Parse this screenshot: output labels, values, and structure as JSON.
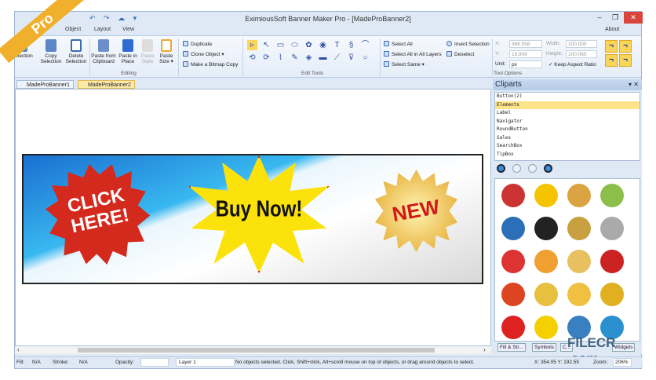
{
  "window": {
    "title": "EximiousSoft Banner Maker Pro - [MadeProBanner2]",
    "minimize": "–",
    "restore": "❐",
    "close": "✕",
    "about": "About",
    "pro_badge": "Pro",
    "qat": "↶ ↷ ☁ ▾"
  },
  "menu": [
    "Object",
    "Layout",
    "View"
  ],
  "ribbon": {
    "editing": {
      "buttons": [
        "Selection",
        "Copy Selection",
        "Delete Selection",
        "Paste from Clipboard",
        "Paste in Place",
        "Paste Style",
        "Paste Size ▾"
      ],
      "label": "Editing"
    },
    "dup": [
      "Duplicate",
      "Clone Object ▾",
      "Make a Bitmap Copy"
    ],
    "edit_tools": {
      "label": "Edit Tools",
      "tools": [
        "▹",
        "↖",
        "▭",
        "⬭",
        "✿",
        "◉",
        "T",
        "§",
        "⌒",
        "⟲",
        "⟳",
        "⌇",
        "✎",
        "◈",
        "▬",
        "⟋",
        "⊽",
        "○"
      ]
    },
    "select": [
      "Select All",
      "Select All in All Layers",
      "Select Same ▾",
      "Invert Selection",
      "Deselect"
    ],
    "tool_options": {
      "label": "Tool Options",
      "x_label": "X:",
      "x": "368.558",
      "y_label": "Y:",
      "y": "19.906",
      "unit_label": "Unit:",
      "unit": "px",
      "width_label": "Width:",
      "width": "100.000",
      "height_label": "Height:",
      "height": "100.065",
      "keep_aspect": "Keep Aspect Ratio"
    }
  },
  "doc_tabs": [
    "MadeProBanner1",
    "MadeProBanner2"
  ],
  "banner": {
    "click": "CLICK HERE!",
    "buy": "Buy Now!",
    "new": "NEW"
  },
  "panel": {
    "title": "Cliparts",
    "items": [
      "Button(2)",
      "Elements",
      "Label",
      "Navigator",
      "RoundButton",
      "Sales",
      "SearchBox",
      "TipBox"
    ],
    "selected": "Elements",
    "tabs": [
      "Fill & Str...",
      "Symbols",
      "C...",
      "Widgets"
    ]
  },
  "status": {
    "fill_label": "Fill:",
    "fill": "N/A",
    "stroke_label": "Stroke:",
    "stroke": "N/A",
    "opacity_label": "Opacity:",
    "layer": "Layer 1",
    "message": "No objects selected. Click, Shift+click, Alt+scroll mouse on top of objects, or drag around objects to select.",
    "coords": "X: 354.05 Y: 192.55",
    "zoom_label": "Zoom:",
    "zoom": "206%"
  },
  "watermark": "FILECR .com"
}
